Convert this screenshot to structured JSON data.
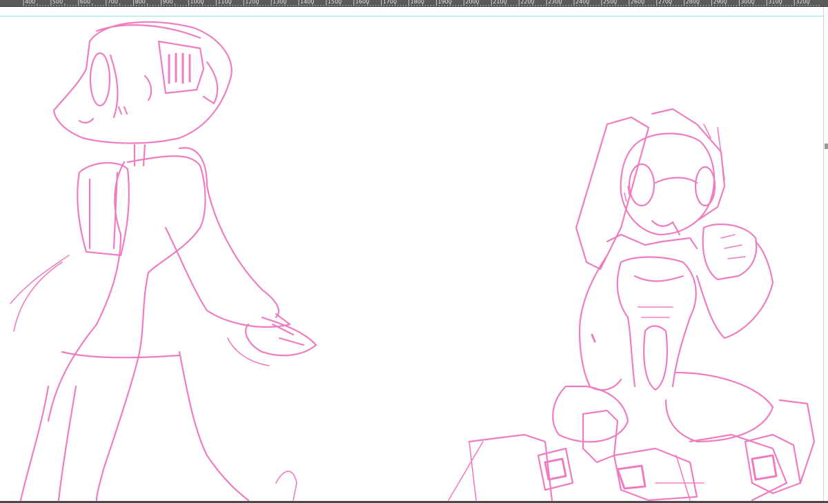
{
  "ruler": {
    "labels": [
      "400",
      "500",
      "600",
      "700",
      "800",
      "900",
      "1000",
      "1100",
      "1200",
      "1300",
      "1400",
      "1500",
      "1600",
      "1700",
      "1800",
      "1900",
      "2000",
      "2100",
      "2200",
      "2300",
      "2400",
      "2500",
      "2600",
      "2700",
      "2800",
      "2900",
      "3000",
      "3100",
      "3200"
    ]
  },
  "colors": {
    "stroke": "#f07cc0",
    "guide": "#8de3ee",
    "ruler_bg": "#5a5a5a"
  },
  "canvas": {
    "content": "pink pencil sketch of two robot girl characters"
  }
}
